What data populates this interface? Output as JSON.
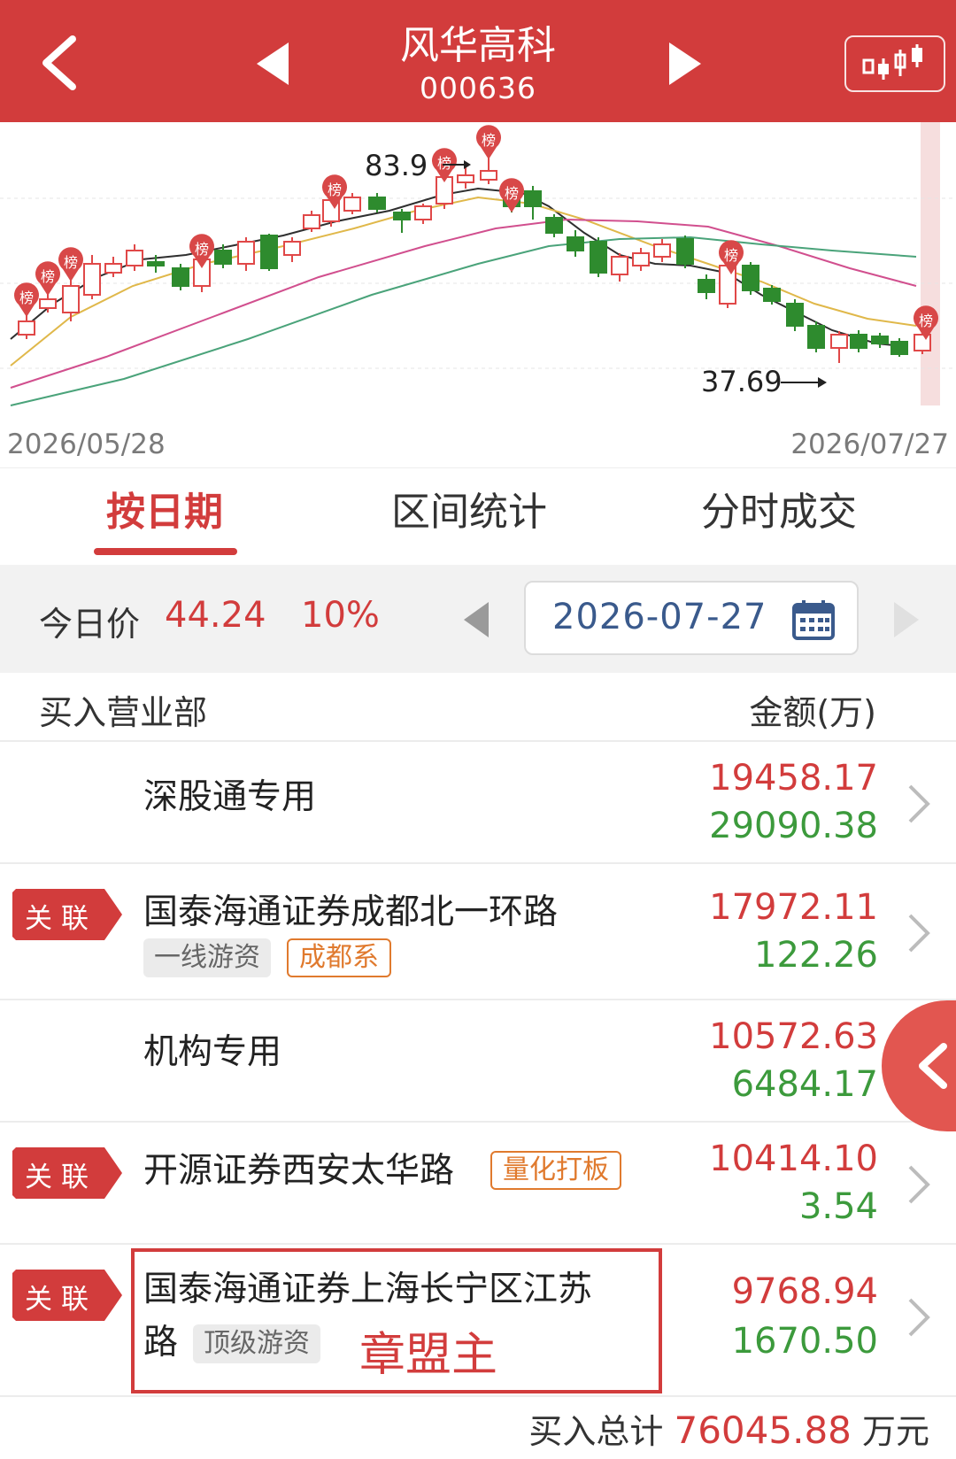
{
  "header": {
    "stock_name": "风华高科",
    "stock_code": "000636"
  },
  "chart": {
    "start_date": "2026/05/28",
    "end_date": "2026/07/27",
    "high_label": "83.9",
    "low_label": "37.69",
    "marker_label": "榜"
  },
  "tabs": [
    "按日期",
    "区间统计",
    "分时成交"
  ],
  "price_bar": {
    "label": "今日价",
    "price": "44.24",
    "change": "10%",
    "date": "2026-07-27"
  },
  "list_header": {
    "left": "买入营业部",
    "right": "金额(万)"
  },
  "rows": [
    {
      "name": "深股通专用",
      "buy": "19458.17",
      "sell": "29090.38",
      "badge": "",
      "tags": []
    },
    {
      "name": "国泰海通证券成都北一环路",
      "buy": "17972.11",
      "sell": "122.26",
      "badge": "关联",
      "tags": [
        "一线游资",
        "成都系"
      ]
    },
    {
      "name": "机构专用",
      "buy": "10572.63",
      "sell": "6484.17",
      "badge": "",
      "tags": []
    },
    {
      "name": "开源证券西安太华路",
      "buy": "10414.10",
      "sell": "3.54",
      "badge": "关联",
      "tags": [
        "量化打板"
      ]
    },
    {
      "name_line1": "国泰海通证券上海长宁区江苏",
      "name_line2": "路",
      "buy": "9768.94",
      "sell": "1670.50",
      "badge": "关联",
      "tags": [
        "顶级游资"
      ]
    }
  ],
  "annotation": "章盟主",
  "total": {
    "label": "买入总计",
    "value": "76045.88",
    "unit": "万元"
  },
  "colors": {
    "brand_red": "#d23c3c",
    "down_green": "#3c9a3c",
    "tag_orange": "#e07a2e"
  }
}
